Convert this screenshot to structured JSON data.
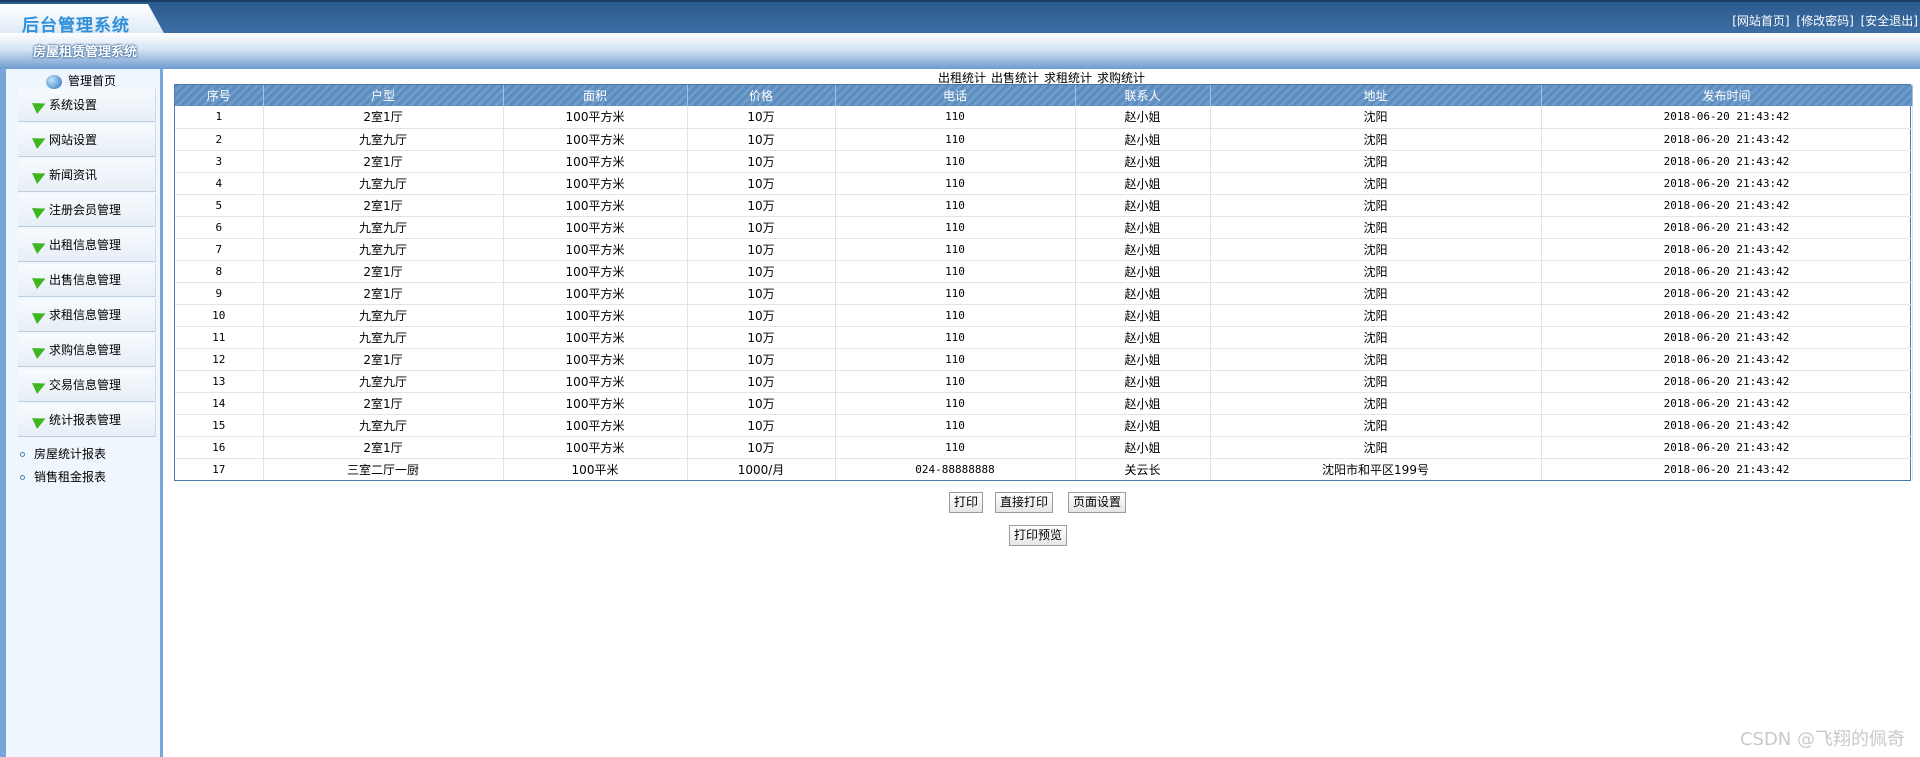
{
  "header": {
    "logo": "后台管理系统",
    "system_name": "房屋租赁管理系统",
    "links": [
      "[网站首页]",
      "[修改密码]",
      "[安全退出]"
    ]
  },
  "sidebar": {
    "home": "管理首页",
    "items": [
      "系统设置",
      "网站设置",
      "新闻资讯",
      "注册会员管理",
      "出租信息管理",
      "出售信息管理",
      "求租信息管理",
      "求购信息管理",
      "交易信息管理",
      "统计报表管理"
    ],
    "sub_items": [
      "房屋统计报表",
      "销售租金报表"
    ]
  },
  "tabs": [
    "出租统计",
    "出售统计",
    "求租统计",
    "求购统计"
  ],
  "table": {
    "columns": [
      "序号",
      "户型",
      "面积",
      "价格",
      "电话",
      "联系人",
      "地址",
      "发布时间"
    ],
    "rows": [
      [
        "1",
        "2室1厅",
        "100平方米",
        "10万",
        "110",
        "赵小姐",
        "沈阳",
        "2018-06-20 21:43:42"
      ],
      [
        "2",
        "九室九厅",
        "100平方米",
        "10万",
        "110",
        "赵小姐",
        "沈阳",
        "2018-06-20 21:43:42"
      ],
      [
        "3",
        "2室1厅",
        "100平方米",
        "10万",
        "110",
        "赵小姐",
        "沈阳",
        "2018-06-20 21:43:42"
      ],
      [
        "4",
        "九室九厅",
        "100平方米",
        "10万",
        "110",
        "赵小姐",
        "沈阳",
        "2018-06-20 21:43:42"
      ],
      [
        "5",
        "2室1厅",
        "100平方米",
        "10万",
        "110",
        "赵小姐",
        "沈阳",
        "2018-06-20 21:43:42"
      ],
      [
        "6",
        "九室九厅",
        "100平方米",
        "10万",
        "110",
        "赵小姐",
        "沈阳",
        "2018-06-20 21:43:42"
      ],
      [
        "7",
        "九室九厅",
        "100平方米",
        "10万",
        "110",
        "赵小姐",
        "沈阳",
        "2018-06-20 21:43:42"
      ],
      [
        "8",
        "2室1厅",
        "100平方米",
        "10万",
        "110",
        "赵小姐",
        "沈阳",
        "2018-06-20 21:43:42"
      ],
      [
        "9",
        "2室1厅",
        "100平方米",
        "10万",
        "110",
        "赵小姐",
        "沈阳",
        "2018-06-20 21:43:42"
      ],
      [
        "10",
        "九室九厅",
        "100平方米",
        "10万",
        "110",
        "赵小姐",
        "沈阳",
        "2018-06-20 21:43:42"
      ],
      [
        "11",
        "九室九厅",
        "100平方米",
        "10万",
        "110",
        "赵小姐",
        "沈阳",
        "2018-06-20 21:43:42"
      ],
      [
        "12",
        "2室1厅",
        "100平方米",
        "10万",
        "110",
        "赵小姐",
        "沈阳",
        "2018-06-20 21:43:42"
      ],
      [
        "13",
        "九室九厅",
        "100平方米",
        "10万",
        "110",
        "赵小姐",
        "沈阳",
        "2018-06-20 21:43:42"
      ],
      [
        "14",
        "2室1厅",
        "100平方米",
        "10万",
        "110",
        "赵小姐",
        "沈阳",
        "2018-06-20 21:43:42"
      ],
      [
        "15",
        "九室九厅",
        "100平方米",
        "10万",
        "110",
        "赵小姐",
        "沈阳",
        "2018-06-20 21:43:42"
      ],
      [
        "16",
        "2室1厅",
        "100平方米",
        "10万",
        "110",
        "赵小姐",
        "沈阳",
        "2018-06-20 21:43:42"
      ],
      [
        "17",
        "三室二厅一厨",
        "100平米",
        "1000/月",
        "024-88888888",
        "关云长",
        "沈阳市和平区199号",
        "2018-06-20 21:43:42"
      ]
    ]
  },
  "buttons": {
    "print": "打印",
    "direct_print": "直接打印",
    "page_setup": "页面设置",
    "print_preview": "打印预览"
  },
  "watermark": "CSDN @飞翔的佩奇",
  "colors": {
    "header": "#2b5a8e",
    "accent": "#79a6da",
    "table_header": "#6e9ccb",
    "arrow": "#3fb51f"
  }
}
